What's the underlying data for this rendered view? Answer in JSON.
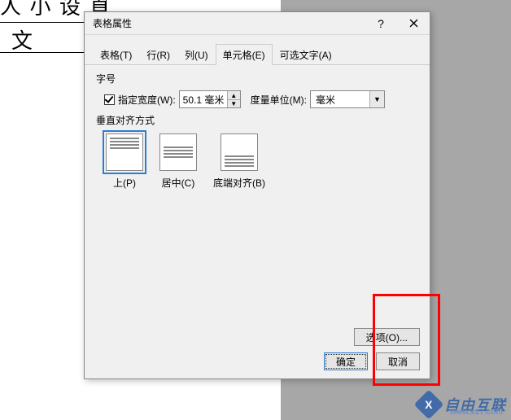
{
  "bg": {
    "line1": "人    小  设     直",
    "line2": "文"
  },
  "dialog": {
    "title": "表格属性",
    "help": "?",
    "tabs": [
      {
        "label": "表格(T)"
      },
      {
        "label": "行(R)"
      },
      {
        "label": "列(U)"
      },
      {
        "label": "单元格(E)"
      },
      {
        "label": "可选文字(A)"
      }
    ],
    "size_label": "字号",
    "width_check": "指定宽度(W):",
    "width_value": "50.1 毫米",
    "unit_label": "度量单位(M):",
    "unit_value": "毫米",
    "valign_label": "垂直对齐方式",
    "valign_options": [
      {
        "label": "上(P)"
      },
      {
        "label": "居中(C)"
      },
      {
        "label": "底端对齐(B)"
      }
    ],
    "options_btn": "选项(O)...",
    "ok": "确定",
    "cancel": "取消"
  },
  "watermark": {
    "text": "自由互联",
    "url": "www.xz7.com"
  }
}
